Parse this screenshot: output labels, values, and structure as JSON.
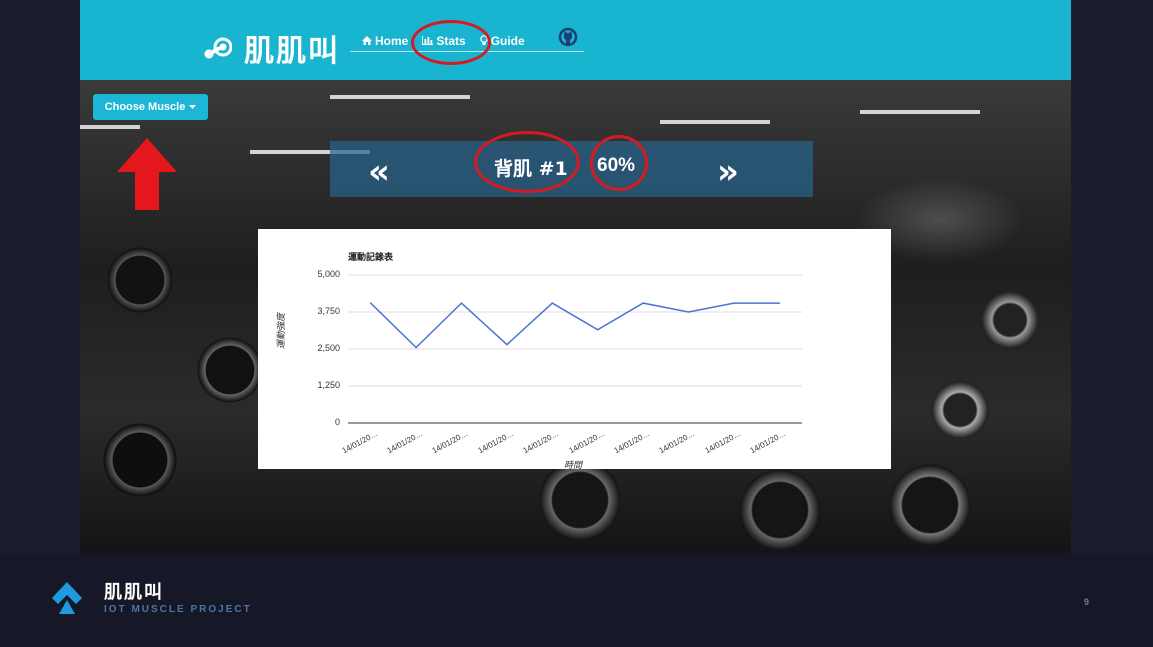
{
  "app": {
    "title": "肌肌叫"
  },
  "nav": {
    "home": "Home",
    "stats": "Stats",
    "guide": "Guide"
  },
  "choose_muscle": {
    "label": "Choose Muscle"
  },
  "selector": {
    "muscle": "背肌 #1",
    "percent": "60%",
    "prev": "«",
    "next": "»"
  },
  "chart_data": {
    "type": "line",
    "title": "運動記錄表",
    "xlabel": "時間",
    "ylabel": "運動強度",
    "ylim": [
      0,
      5000
    ],
    "yticks": [
      "5,000",
      "3,750",
      "2,500",
      "1,250",
      "0"
    ],
    "categories": [
      "14/01/20…",
      "14/01/20…",
      "14/01/20…",
      "14/01/20…",
      "14/01/20…",
      "14/01/20…",
      "14/01/20…",
      "14/01/20…",
      "14/01/20…",
      "14/01/20…"
    ],
    "values": [
      4050,
      2550,
      4050,
      2650,
      4050,
      3150,
      4050,
      3750,
      4050,
      4050
    ],
    "color": "#4a72d6",
    "grid": true
  },
  "footer": {
    "title": "肌肌叫",
    "subtitle": "IOT MUSCLE PROJECT",
    "page": "9"
  },
  "colors": {
    "accent": "#18b4d0",
    "annotation": "#d71920"
  }
}
